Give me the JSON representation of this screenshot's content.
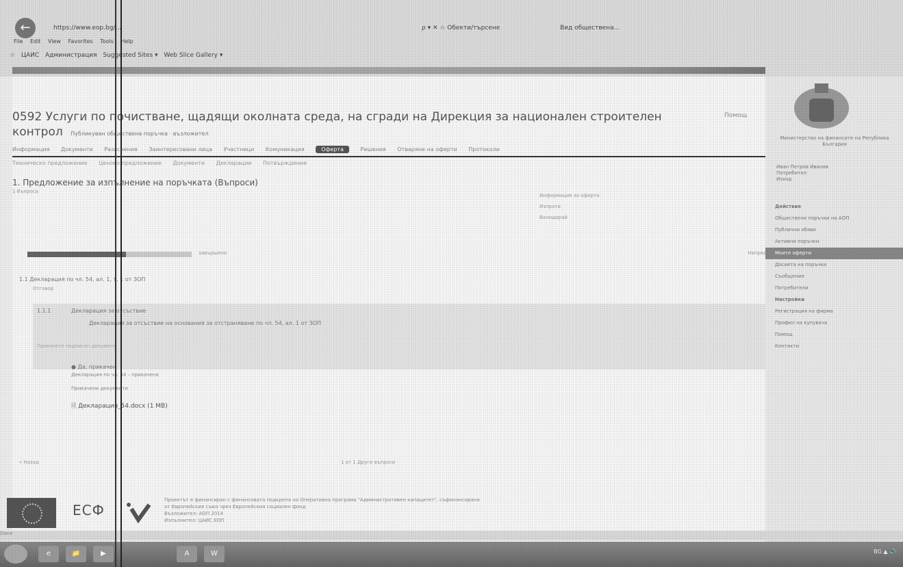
{
  "browser": {
    "back_icon": "back-arrow-icon",
    "url": "https://www.eop.bg/...",
    "url_controls": "ρ ▾ ✕ ☆ Обекти/търсене",
    "tab_title": "Вид обществена...",
    "menu": [
      "File",
      "Edit",
      "View",
      "Favorites",
      "Tools",
      "Help"
    ],
    "favorites": [
      "ЦАИС",
      "Администрация",
      "Suggested Sites ▾",
      "Web Slice Gallery ▾"
    ],
    "status": "Done"
  },
  "page": {
    "title": "0592 Услуги по почистване, щадящи околната среда, на сгради на Дирекция за национален строителен контрол",
    "title_meta": "Публикуван обществена поръчка · възложител",
    "help": "Помощ",
    "tabs": [
      "Информация",
      "Документи",
      "Разяснения",
      "Заинтересовани лица",
      "Участници",
      "Комуникация",
      "Оферта",
      "Решения",
      "Отваряне на оферти",
      "Протоколи"
    ],
    "active_tab": "Оферта",
    "sub_tabs": [
      "Техническо предложение",
      "Ценово предложение",
      "Документи",
      "Декларации",
      "Потвърждение"
    ],
    "section_heading": "1. Предложение за изпълнение на поръчката (Въпроси)",
    "section_sub": "1 Въпроса",
    "right_box": [
      "Информация за оферта",
      "Изпрати",
      "Валидирай"
    ],
    "progress_label": "завършено",
    "progress_fraction": 0.6,
    "progress_right": "Напред",
    "item_line": "1.1 Декларация по чл. 54, ал. 1, т. 1 от ЗОП",
    "item_sub": "Отговор",
    "question": {
      "number": "1.1.1",
      "title": "Декларация за отсъствие",
      "description": "Декларация за отсъствие на основания за отстраняване по чл. 54, ал. 1 от ЗОП",
      "extra": "Прикачете подписан документ"
    },
    "answer_yes": "Да, прикачен",
    "answer_note": "Декларация по чл. 54 – прикачена",
    "docs_label": "Прикачени документи",
    "doc_link": "Декларация_54.docx (1 MB)",
    "nav_back": "« Назад",
    "nav_mid": "1 от 1 Други въпроси"
  },
  "footer": {
    "esf": "ЕСФ",
    "text_lines": [
      "Проектът е финансиран с финансовата подкрепа на Оперативна програма \"Административен капацитет\", съфинансирана",
      "от Европейския съюз чрез Европейския социален фонд",
      "Възложител: АОП 2014",
      "Изпълнител: ЦАИС ЕОП"
    ]
  },
  "sidebar": {
    "ministry": "Министерство на финансите на Република България",
    "user_lines": [
      "Иван Петров Иванов",
      "Потребител",
      "Изход"
    ],
    "menu": [
      {
        "label": "Действия",
        "head": true
      },
      {
        "label": "Обществени поръчки на АОП",
        "head": false
      },
      {
        "label": "Публични обяви",
        "head": false
      },
      {
        "label": "Активни поръчки",
        "head": false
      },
      {
        "label": "Моите оферти",
        "head": false,
        "active": true
      },
      {
        "label": "Досиета на поръчки",
        "head": false
      },
      {
        "label": "Съобщения",
        "head": false
      },
      {
        "label": "Потребители",
        "head": false
      },
      {
        "label": "Настройки",
        "head": true
      },
      {
        "label": "Регистрация на фирма",
        "head": false
      },
      {
        "label": "Профил на купувача",
        "head": false
      },
      {
        "label": "Помощ",
        "head": false
      },
      {
        "label": "Контакти",
        "head": false
      }
    ]
  },
  "taskbar": {
    "buttons": [
      "e",
      "📁",
      "▶",
      "A",
      "W"
    ],
    "tray": "BG ▲ 🔊"
  }
}
